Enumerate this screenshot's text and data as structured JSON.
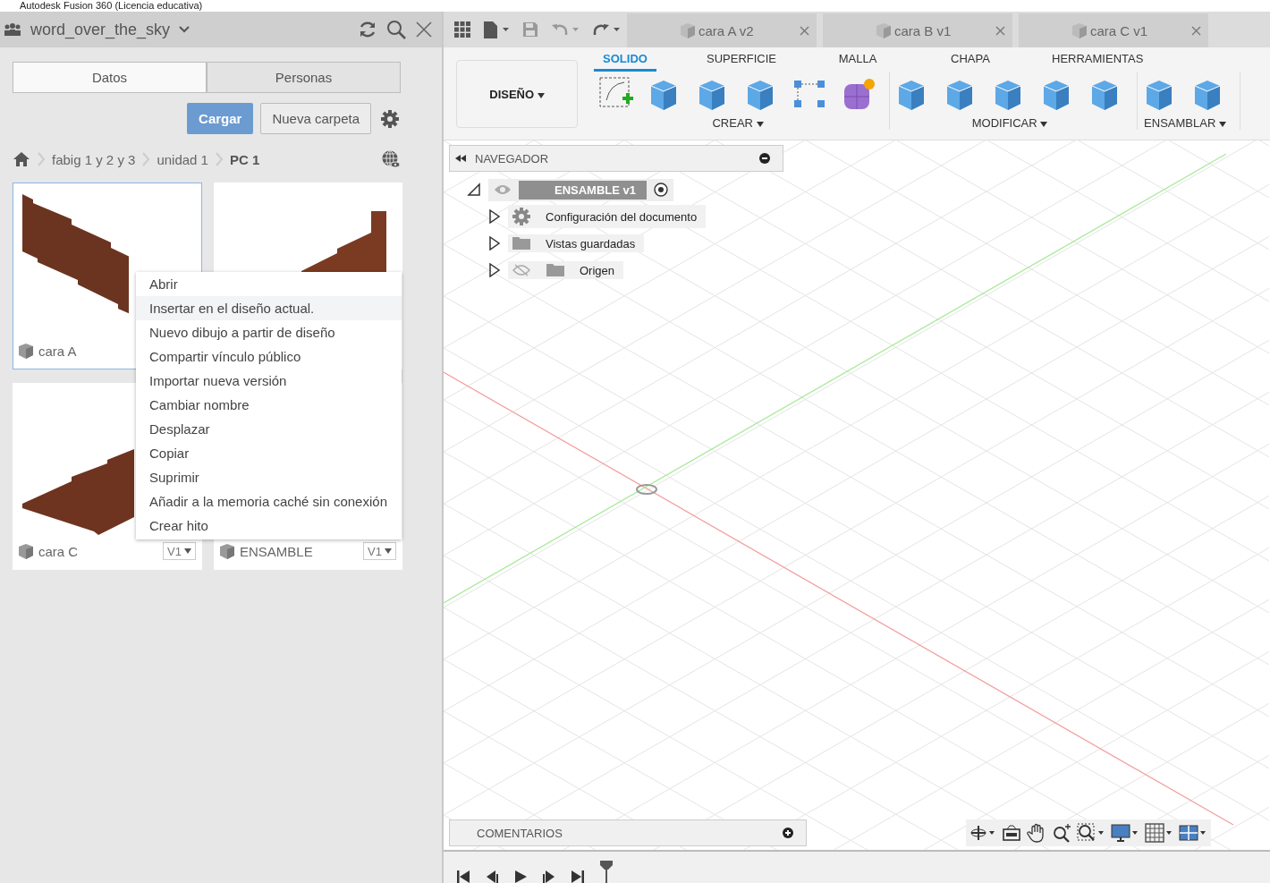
{
  "window": {
    "title": "Autodesk Fusion 360 (Licencia educativa)"
  },
  "data_panel": {
    "project": "word_over_the_sky",
    "tabs": [
      {
        "label": "Datos",
        "selected": true
      },
      {
        "label": "Personas",
        "selected": false
      }
    ],
    "upload_button": "Cargar",
    "new_folder_button": "Nueva carpeta",
    "breadcrumb": [
      "fabig 1 y 2 y 3",
      "unidad 1",
      "PC 1"
    ],
    "cards": [
      {
        "kind": "panel-down",
        "name": "cara A",
        "selected": true
      },
      {
        "kind": "panel-up",
        "selected": false
      },
      {
        "kind": "plate",
        "name": "cara C",
        "version": "V1",
        "selected": false
      },
      {
        "kind": "none",
        "name": "ENSAMBLE",
        "version": "V1",
        "selected": false
      }
    ],
    "context_menu": [
      {
        "label": "Abrir",
        "selected": false
      },
      {
        "label": "Insertar en el diseño actual.",
        "selected": true
      },
      {
        "label": "Nuevo dibujo a partir de diseño",
        "selected": false
      },
      {
        "label": "Compartir vínculo público",
        "selected": false
      },
      {
        "label": "Importar nueva versión",
        "selected": false
      },
      {
        "label": "Cambiar nombre",
        "selected": false
      },
      {
        "label": "Desplazar",
        "selected": false
      },
      {
        "label": "Copiar",
        "selected": false
      },
      {
        "label": "Suprimir",
        "selected": false
      },
      {
        "label": "Añadir a la memoria caché sin conexión",
        "selected": false
      },
      {
        "label": "Crear hito",
        "selected": false
      }
    ]
  },
  "document_tabs": [
    {
      "label": "cara A v2"
    },
    {
      "label": "cara B v1"
    },
    {
      "label": "cara C v1"
    }
  ],
  "workspace": "DISEÑO",
  "ribbon_tabs": [
    {
      "label": "SOLIDO",
      "selected": true
    },
    {
      "label": "SUPERFICIE",
      "selected": false
    },
    {
      "label": "MALLA",
      "selected": false
    },
    {
      "label": "CHAPA",
      "selected": false
    },
    {
      "label": "HERRAMIENTAS",
      "selected": false
    }
  ],
  "ribbon_groups": [
    {
      "label": "CREAR"
    },
    {
      "label": "MODIFICAR"
    },
    {
      "label": "ENSAMBLAR"
    }
  ],
  "navigator": {
    "title": "NAVEGADOR",
    "root": {
      "label": "ENSAMBLE v1",
      "expanded": true,
      "children": [
        {
          "kind": "settings",
          "label": "Configuración del documento",
          "hidden": false,
          "expanded": false
        },
        {
          "kind": "folder",
          "label": "Vistas guardadas",
          "hidden": false,
          "expanded": false
        },
        {
          "kind": "folder",
          "label": "Origen",
          "hidden": true,
          "expanded": false
        }
      ]
    }
  },
  "comments": {
    "title": "COMENTARIOS"
  }
}
